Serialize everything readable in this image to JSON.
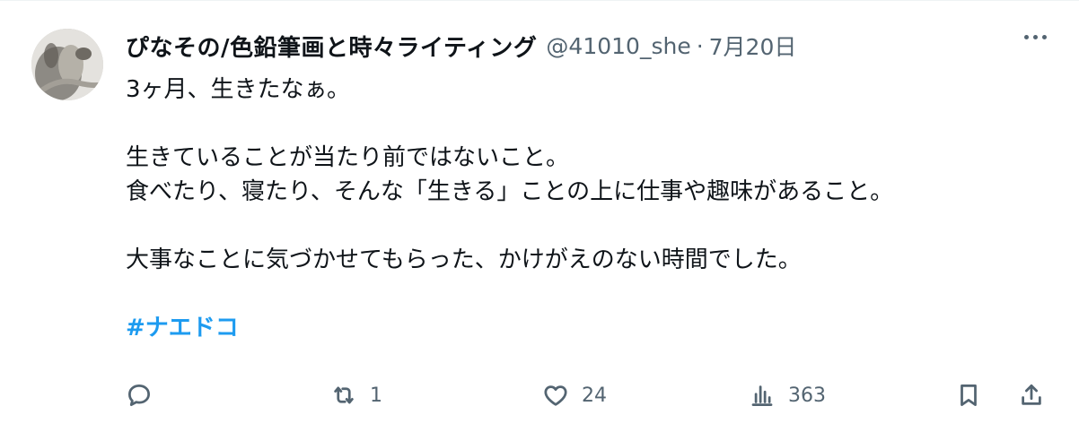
{
  "tweet": {
    "author_name": "ぴなその/色鉛筆画と時々ライティング",
    "handle": "@41010_she",
    "separator": "·",
    "date": "7月20日",
    "lines": [
      "3ヶ月、生きたなぁ。",
      "",
      "生きていることが当たり前ではないこと。",
      "食べたり、寝たり、そんな「生きる」ことの上に仕事や趣味があること。",
      "",
      "大事なことに気づかせてもらった、かけがえのない時間でした。",
      ""
    ],
    "hashtag": "#ナエドコ"
  },
  "actions": {
    "reply_count": "",
    "retweet_count": "1",
    "like_count": "24",
    "views_count": "363"
  },
  "icons": [
    "reply-icon",
    "retweet-icon",
    "like-icon",
    "views-icon",
    "bookmark-icon",
    "share-icon",
    "more-icon"
  ],
  "colors": {
    "link": "#1d9bf0",
    "secondary_text": "#536471",
    "primary_text": "#0f1419"
  }
}
